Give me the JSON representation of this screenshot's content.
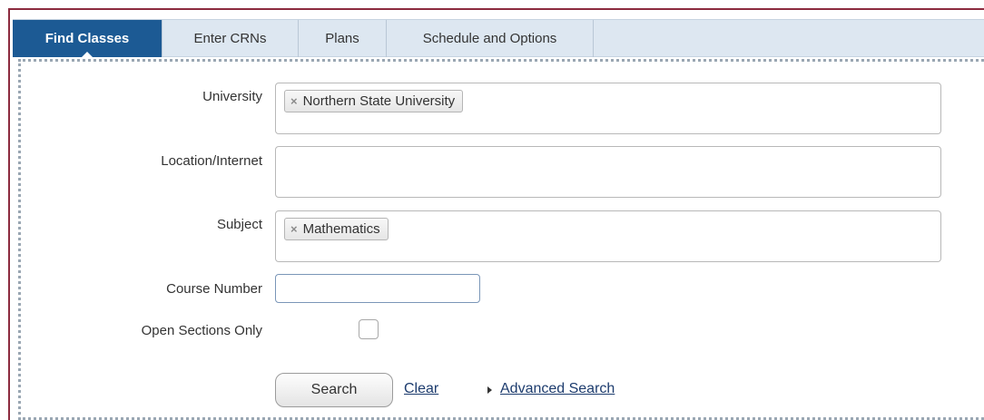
{
  "tabs": [
    {
      "label": "Find Classes",
      "active": true
    },
    {
      "label": "Enter CRNs",
      "active": false
    },
    {
      "label": "Plans",
      "active": false
    },
    {
      "label": "Schedule and Options",
      "active": false
    }
  ],
  "form": {
    "university": {
      "label": "University",
      "selected": [
        "Northern State University"
      ],
      "remove_glyph": "×"
    },
    "location": {
      "label": "Location/Internet",
      "selected": []
    },
    "subject": {
      "label": "Subject",
      "selected": [
        "Mathematics"
      ],
      "remove_glyph": "×"
    },
    "course_number": {
      "label": "Course Number",
      "value": "",
      "placeholder": ""
    },
    "open_sections": {
      "label": "Open Sections Only",
      "checked": false
    }
  },
  "actions": {
    "search_label": "Search",
    "clear_label": "Clear",
    "advanced_label": "Advanced Search",
    "advanced_icon": "triangle-right-icon"
  },
  "colors": {
    "active_tab": "#1c5a94",
    "tab_bar": "#dde7f1",
    "frame_border": "#8c2b3f",
    "link": "#1d3c6e"
  }
}
